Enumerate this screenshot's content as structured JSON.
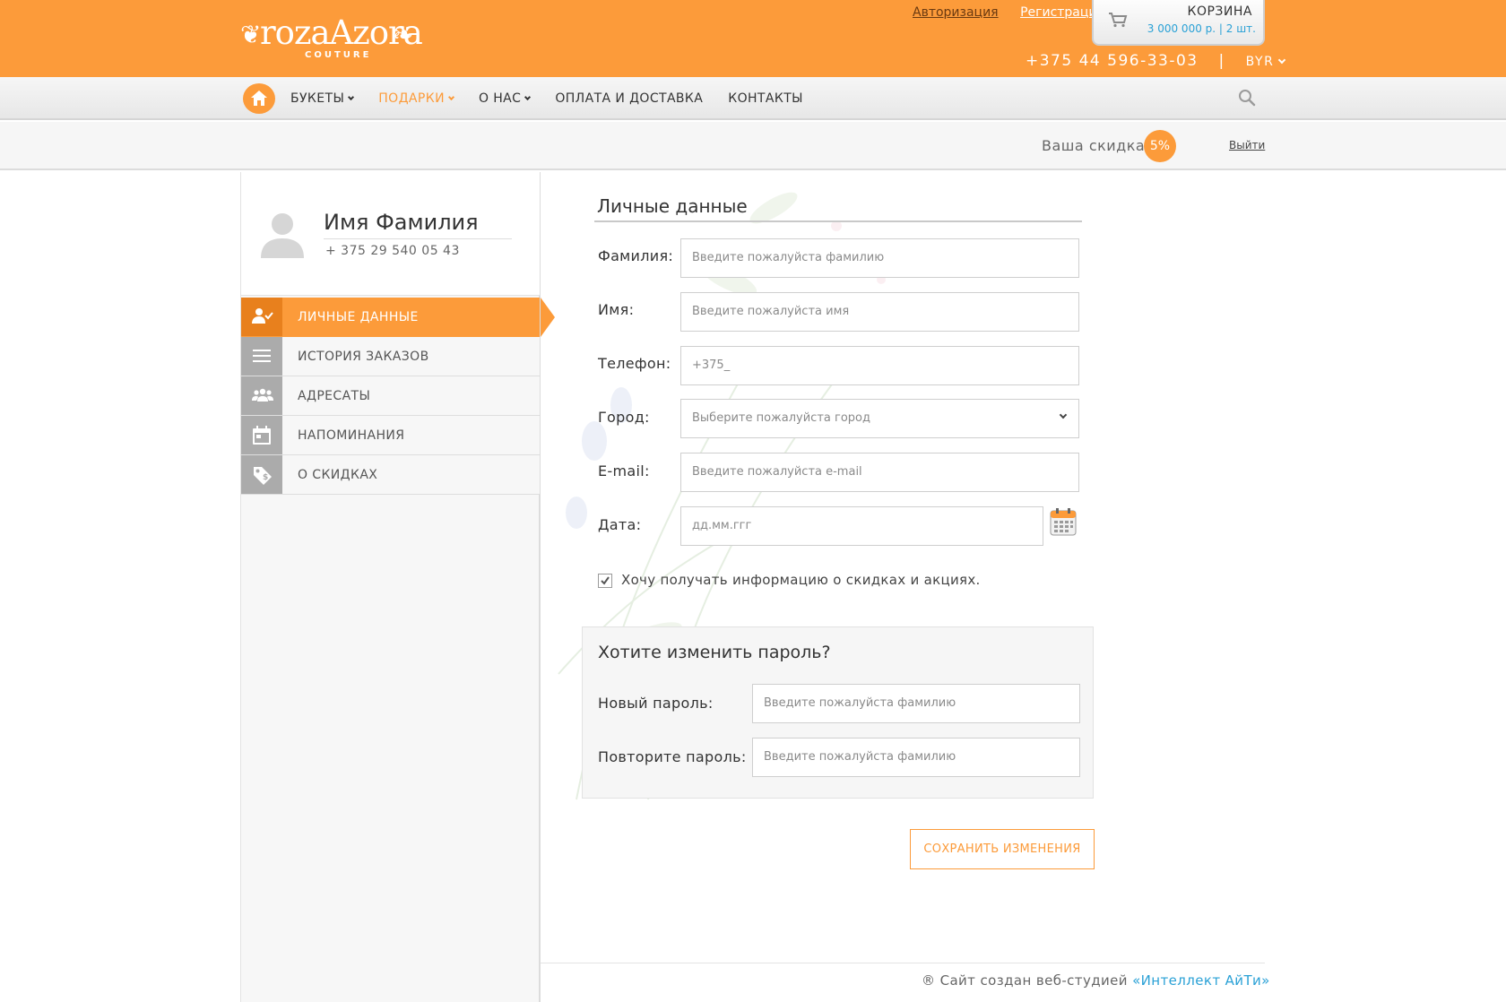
{
  "header": {
    "logo_text": "rozaAzora",
    "logo_subtitle": "COUTURE",
    "login_link": "Авторизация",
    "register_link": "Регистрация",
    "phone": "+375 44 596-33-03",
    "phone_separator": "|",
    "currency": "BYR",
    "cart": {
      "title": "КОРЗИНА",
      "summary": "3 000 000 р. | 2 шт."
    }
  },
  "nav": {
    "items": [
      {
        "label": "БУКЕТЫ",
        "has_dropdown": true,
        "active": false
      },
      {
        "label": "ПОДАРКИ",
        "has_dropdown": true,
        "active": true
      },
      {
        "label": "О НАС",
        "has_dropdown": true,
        "active": false
      },
      {
        "label": "ОПЛАТА И ДОСТАВКА",
        "has_dropdown": false,
        "active": false
      },
      {
        "label": "КОНТАКТЫ",
        "has_dropdown": false,
        "active": false
      }
    ]
  },
  "discount": {
    "label": "Ваша скидка:",
    "value": "5%",
    "logout": "Выйти"
  },
  "profile": {
    "name": "Имя Фамилия",
    "phone": "+ 375 29 540 05 43"
  },
  "sidebar_menu": [
    {
      "label": "ЛИЧНЫЕ ДАННЫЕ",
      "icon": "user-check-icon",
      "active": true
    },
    {
      "label": "ИСТОРИЯ ЗАКАЗОВ",
      "icon": "list-icon",
      "active": false
    },
    {
      "label": "АДРЕСАТЫ",
      "icon": "group-icon",
      "active": false
    },
    {
      "label": "НАПОМИНАНИЯ",
      "icon": "calendar-icon",
      "active": false
    },
    {
      "label": "О СКИДКАХ",
      "icon": "tag-icon",
      "active": false
    }
  ],
  "form": {
    "title": "Личные данные",
    "fields": {
      "lastname": {
        "label": "Фамилия:",
        "placeholder": "Введите пожалуйста фамилию"
      },
      "firstname": {
        "label": "Имя:",
        "placeholder": "Введите пожалуйста имя"
      },
      "phone": {
        "label": "Телефон:",
        "value": "+375_"
      },
      "city": {
        "label": "Город:",
        "placeholder": "Выберите пожалуйста город"
      },
      "email": {
        "label": "E-mail:",
        "placeholder": "Введите пожалуйста e-mail"
      },
      "date": {
        "label": "Дата:",
        "placeholder": "дд.мм.ггг"
      }
    },
    "newsletter": {
      "label": "Хочу получать информацию о скидках и акциях.",
      "checked": true
    }
  },
  "password": {
    "title": "Хотите изменить пароль?",
    "new_label": "Новый пароль:",
    "new_placeholder": "Введите пожалуйста фамилию",
    "repeat_label": "Повторите пароль:",
    "repeat_placeholder": "Введите пожалуйста фамилию"
  },
  "save_button": "СОХРАНИТЬ ИЗМЕНЕНИЯ",
  "footer": {
    "text": "® Сайт создан веб-студией",
    "studio": "«Интеллект АйТи»"
  },
  "colors": {
    "accent": "#fc9b3a",
    "link_blue": "#2aa1d6",
    "sidebar_icon_bg": "#ababab"
  }
}
